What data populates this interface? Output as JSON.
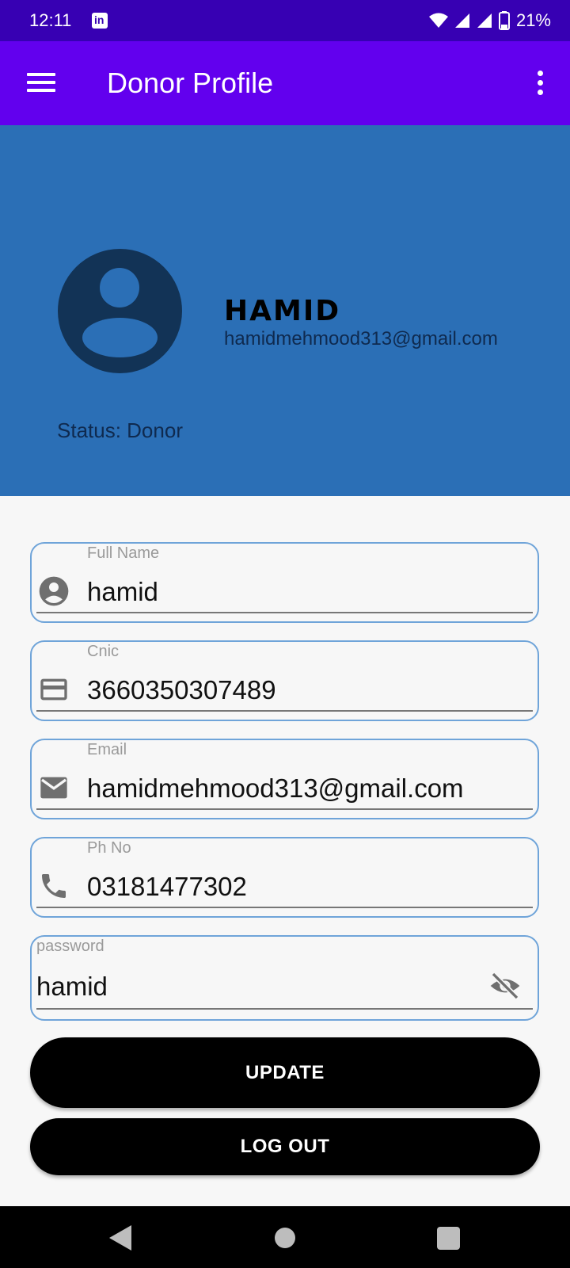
{
  "status_bar": {
    "time": "12:11",
    "notification_icon": "linkedin-icon",
    "battery": "21%",
    "icons": [
      "wifi-icon",
      "signal-icon",
      "signal-icon",
      "battery-icon"
    ]
  },
  "app_bar": {
    "title": "Donor Profile",
    "menu_icon": "hamburger-menu-icon",
    "overflow_icon": "more-vert-icon",
    "color": "#6200ee"
  },
  "profile": {
    "name": "HAMID",
    "email": "hamidmehmood313@gmail.com",
    "status": "Status: Donor",
    "avatar_icon": "account-circle-icon",
    "header_color": "#2b6fb6"
  },
  "form": {
    "full_name": {
      "label": "Full Name",
      "value": "hamid",
      "icon": "account-circle-icon"
    },
    "cnic": {
      "label": "Cnic",
      "value": "3660350307489",
      "icon": "credit-card-icon"
    },
    "email": {
      "label": "Email",
      "value": "hamidmehmood313@gmail.com",
      "icon": "email-icon"
    },
    "phone": {
      "label": "Ph No",
      "value": "03181477302",
      "icon": "phone-icon"
    },
    "password": {
      "label": "password",
      "value": "hamid",
      "toggle_icon": "visibility-off-icon"
    }
  },
  "buttons": {
    "update": "UPDATE",
    "logout": "LOG OUT"
  },
  "nav_bar": {
    "icons": [
      "back-icon",
      "home-icon",
      "recents-icon"
    ]
  }
}
